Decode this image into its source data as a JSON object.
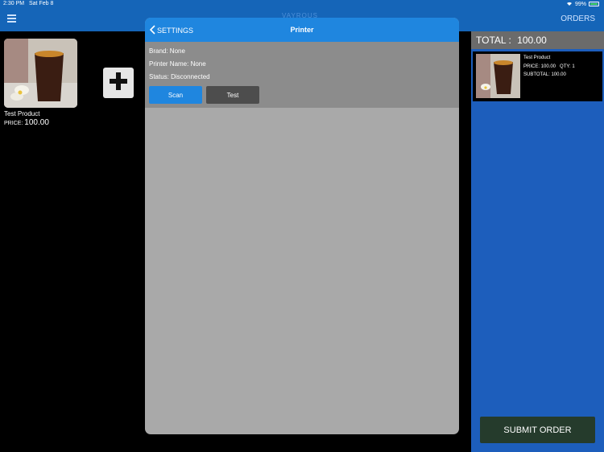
{
  "status_bar": {
    "time": "2:30 PM",
    "date": "Sat Feb 8",
    "battery": "99%"
  },
  "nav": {
    "orders_label": "ORDERS",
    "title": "VAYROUS"
  },
  "products": [
    {
      "name": "Test Product",
      "price_label": "PRICE:",
      "price": "100.00"
    }
  ],
  "cart": {
    "total_label": "TOTAL :",
    "total_value": "100.00",
    "item": {
      "name": "Test Product",
      "price_line": "PRICE: 100.00",
      "qty_line": "QTY: 1",
      "subtotal_line": "SUBTOTAL: 100.00"
    },
    "submit_label": "SUBMIT ORDER"
  },
  "modal": {
    "back_label": "SETTINGS",
    "title": "Printer",
    "brand": "Brand: None",
    "printer_name": "Printer Name: None",
    "status": "Status: Disconnected",
    "scan_label": "Scan",
    "test_label": "Test"
  },
  "colors": {
    "nav_blue": "#1565b8",
    "modal_header": "#1f86df",
    "scan_button": "#1f86df",
    "test_button": "#4d4d4d",
    "submit_button": "#253b2c"
  }
}
